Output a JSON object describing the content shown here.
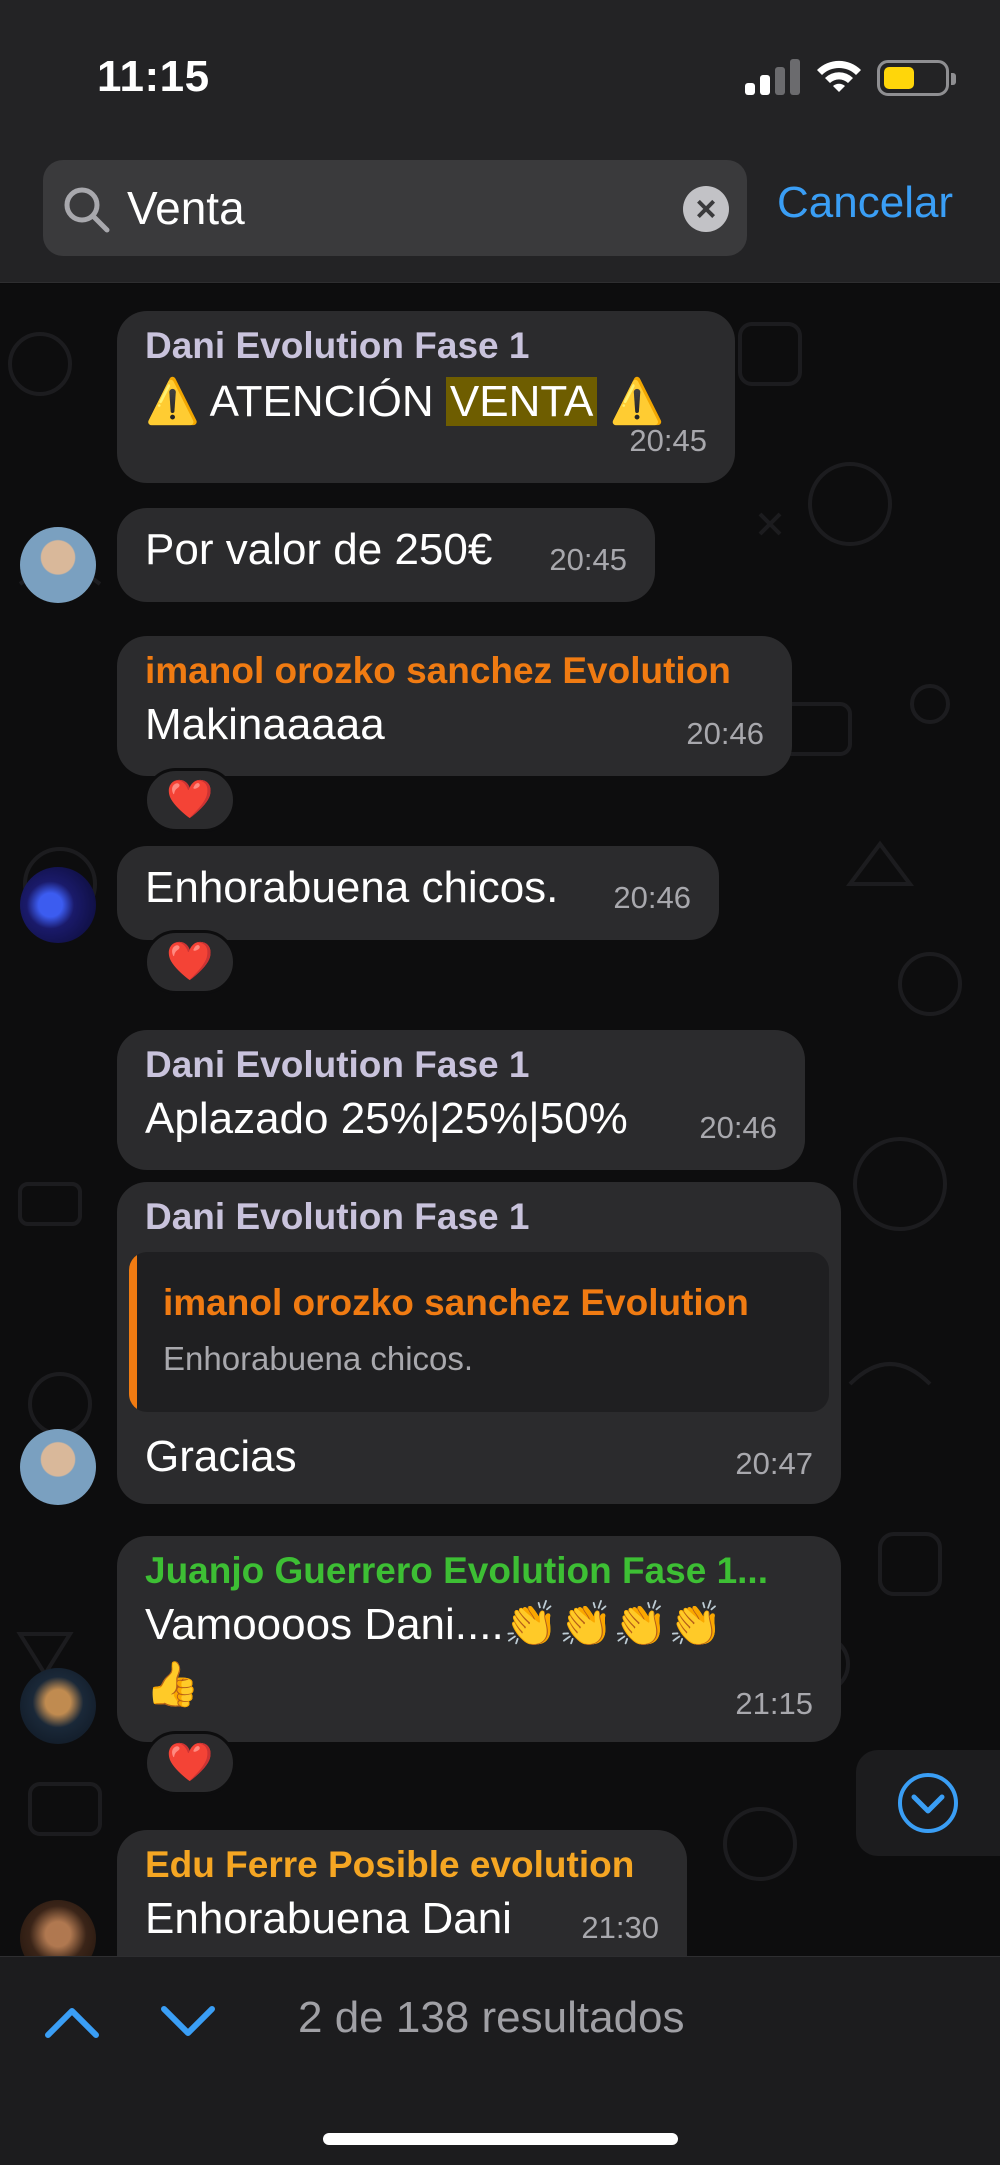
{
  "status_bar": {
    "time": "11:15"
  },
  "search": {
    "query": "Venta",
    "cancel_label": "Cancelar"
  },
  "messages": [
    {
      "sender": "Dani Evolution Fase 1",
      "text_before": "⚠️ ATENCIÓN ",
      "highlight": "VENTA",
      "text_after": " ⚠️",
      "time": "20:45"
    },
    {
      "text": "Por valor de 250€",
      "time": "20:45"
    },
    {
      "sender": "imanol orozko sanchez Evolution",
      "text": "Makinaaaaa",
      "time": "20:46",
      "reaction": "❤️"
    },
    {
      "text": "Enhorabuena chicos.",
      "time": "20:46",
      "reaction": "❤️"
    },
    {
      "sender": "Dani Evolution Fase 1",
      "text": "Aplazado 25%|25%|50%",
      "time": "20:46"
    },
    {
      "sender": "Dani Evolution Fase 1",
      "reply_sender": "imanol orozko sanchez Evolution",
      "reply_text": "Enhorabuena chicos.",
      "text": "Gracias",
      "time": "20:47"
    },
    {
      "sender": "Juanjo Guerrero Evolution Fase 1...",
      "text": "Vamoooos Dani....👏👏👏👏",
      "text2": "👍",
      "time": "21:15",
      "reaction": "❤️"
    },
    {
      "sender": "Edu Ferre Posible evolution",
      "text": "Enhorabuena Dani",
      "time": "21:30"
    }
  ],
  "footer": {
    "results": "2 de 138 resultados"
  },
  "colors": {
    "accent": "#3a9ef5",
    "sender_dani": "#c9c3dc",
    "sender_imanol": "#f07b12",
    "sender_juanjo": "#3dbf34",
    "sender_edu": "#f5a623",
    "highlight_bg": "#6e5d00"
  }
}
